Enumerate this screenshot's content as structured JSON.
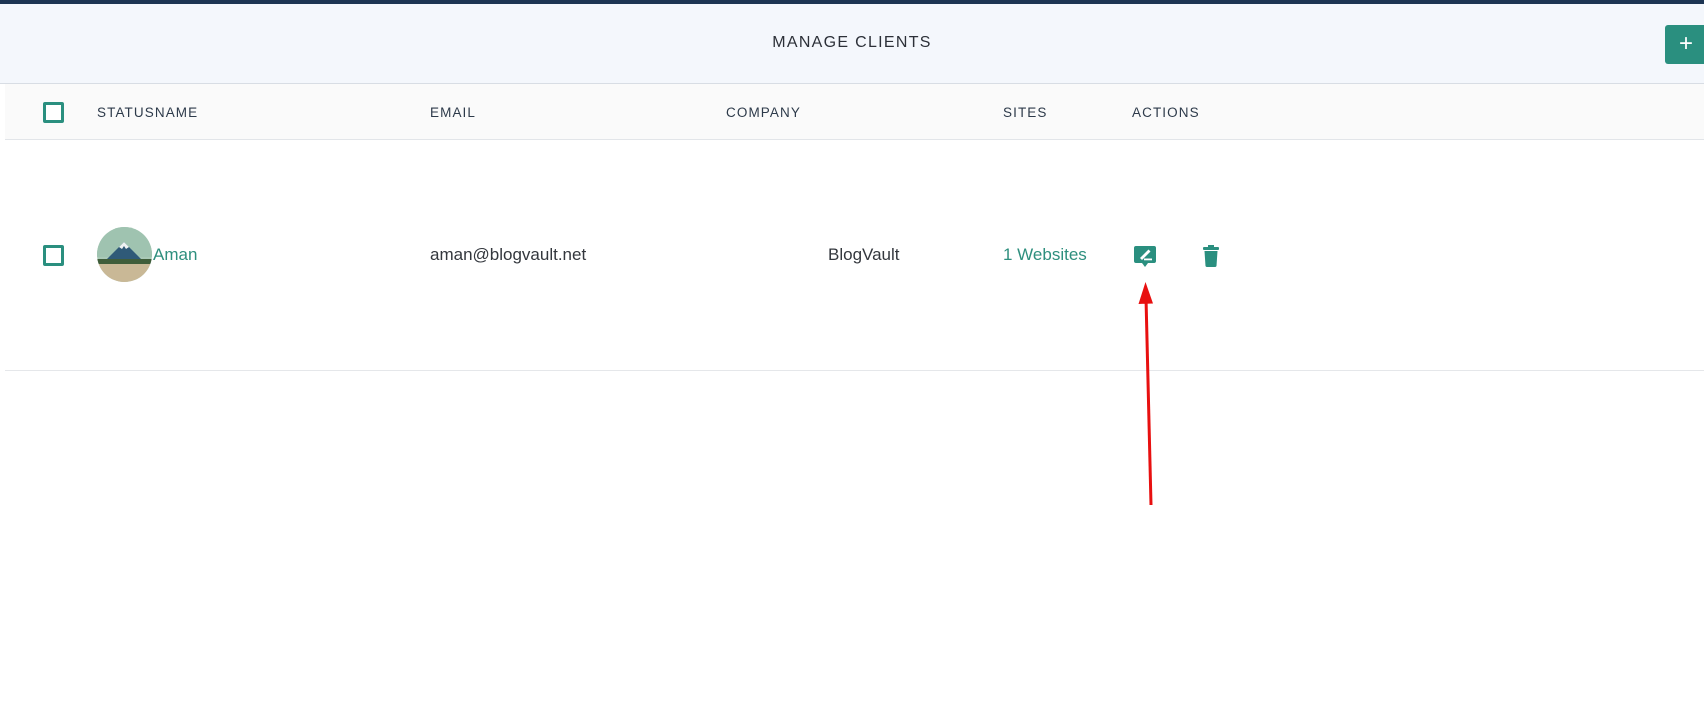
{
  "header": {
    "title": "MANAGE CLIENTS",
    "add_button_label": "+"
  },
  "table": {
    "columns": [
      "STATUSNAME",
      "EMAIL",
      "COMPANY",
      "SITES",
      "ACTIONS"
    ],
    "rows": [
      {
        "name": "Aman",
        "email": "aman@blogvault.net",
        "company": "BlogVault",
        "sites": "1 Websites",
        "actions": [
          "edit-icon",
          "delete-icon"
        ]
      }
    ]
  },
  "colors": {
    "accent": "#2a8f7f",
    "topbar": "#1d3553",
    "annotation_arrow": "#e81010"
  }
}
